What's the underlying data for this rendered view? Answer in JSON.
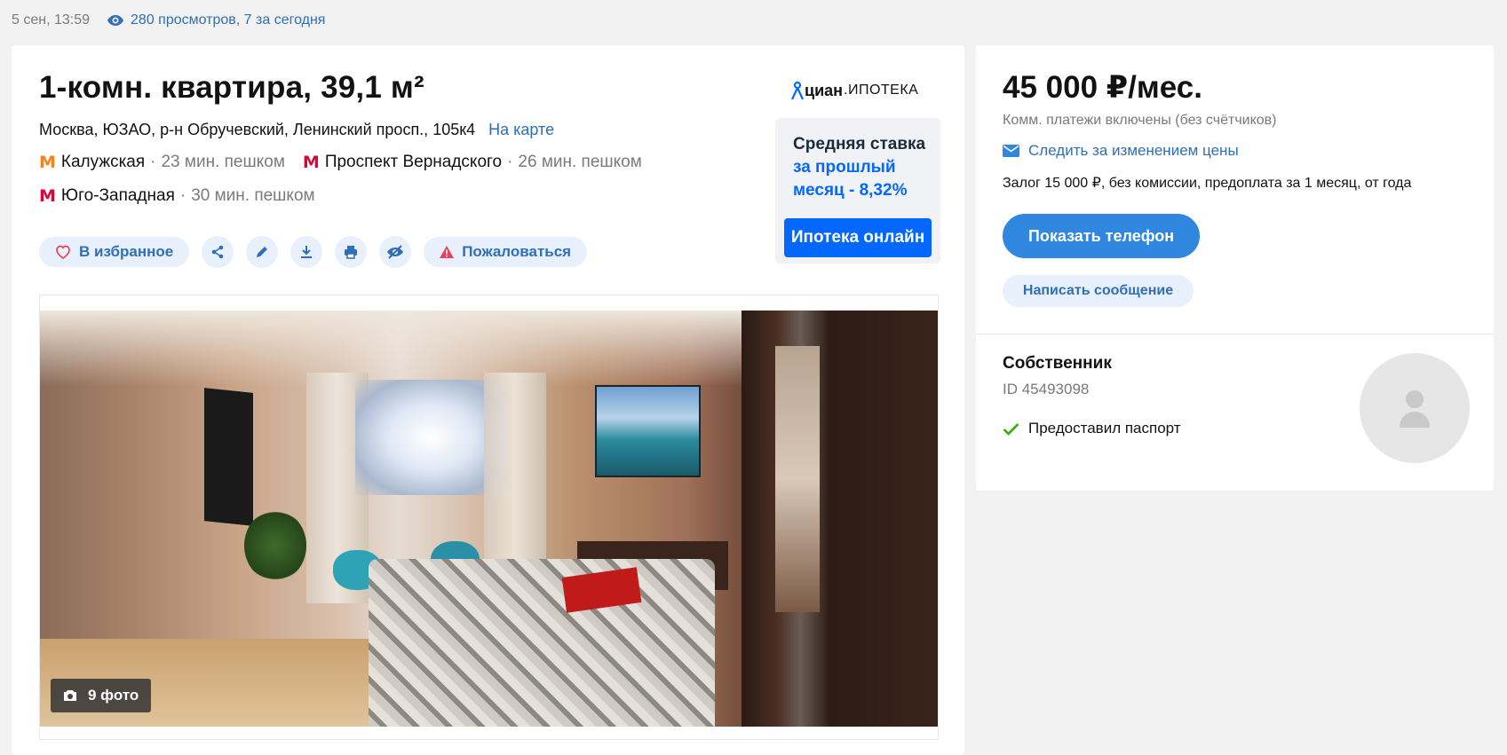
{
  "meta": {
    "date": "5 сен, 13:59",
    "views": "280 просмотров, 7 за сегодня"
  },
  "listing": {
    "title": "1-комн. квартира, 39,1 м²",
    "address": "Москва, ЮЗАО, р-н Обручевский, Ленинский просп., 105к4",
    "map_link": "На карте",
    "metro": [
      {
        "name": "Калужская",
        "time": "23 мин. пешком",
        "color": "#f58220"
      },
      {
        "name": "Проспект Вернадского",
        "time": "26 мин. пешком",
        "color": "#d6083b"
      },
      {
        "name": "Юго-Западная",
        "time": "30 мин. пешком",
        "color": "#d6083b"
      }
    ],
    "separator": "·",
    "actions": {
      "favorite": "В избранное",
      "complain": "Пожаловаться"
    },
    "photo_count": "9 фото"
  },
  "promo": {
    "brand": "циан",
    "brand_suffix": ".ИПОТЕКА",
    "rate_line1": "Средняя ставка",
    "rate_line2": "за прошлый",
    "rate_line3": "месяц - 8,32%",
    "button": "Ипотека онлайн"
  },
  "sidebar": {
    "price": "45 000 ₽/мес.",
    "utilities": "Комм. платежи включены (без счётчиков)",
    "follow_price": "Следить за изменением цены",
    "terms": "Залог 15 000 ₽, без комиссии, предоплата за 1 месяц, от года",
    "show_phone": "Показать телефон",
    "write_message": "Написать сообщение",
    "owner": {
      "title": "Собственник",
      "id": "ID 45493098",
      "passport": "Предоставил паспорт"
    }
  },
  "colors": {
    "accent": "#2f87e0",
    "link": "#2f6fb8",
    "promo_blue": "#0468ff",
    "check_green": "#34ac0a"
  }
}
